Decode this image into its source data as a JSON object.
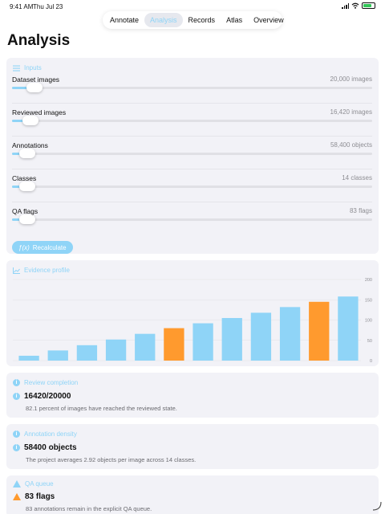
{
  "status_bar": {
    "time": "9:41 AM",
    "date": "Thu Jul 23"
  },
  "tabs": [
    {
      "label": "Annotate",
      "active": false
    },
    {
      "label": "Analysis",
      "active": true
    },
    {
      "label": "Records",
      "active": false
    },
    {
      "label": "Atlas",
      "active": false
    },
    {
      "label": "Overview",
      "active": false
    }
  ],
  "page_title": "Analysis",
  "inputs": {
    "header": "Inputs",
    "header_icon": "list-icon",
    "rows": [
      {
        "label": "Dataset images",
        "value": "20,000 images",
        "level": 0.04
      },
      {
        "label": "Reviewed images",
        "value": "16,420 images",
        "level": 0.03
      },
      {
        "label": "Annotations",
        "value": "58,400 objects",
        "level": 0.02
      },
      {
        "label": "Classes",
        "value": "14 classes",
        "level": 0.02
      },
      {
        "label": "QA flags",
        "value": "83 flags",
        "level": 0.02
      }
    ],
    "button_label": "Recalculate",
    "button_icon": "function-icon"
  },
  "evidence": {
    "header": "Evidence profile",
    "header_icon": "chart-line-icon"
  },
  "chart_data": {
    "type": "bar",
    "title": "",
    "xlabel": "",
    "ylabel": "",
    "ylim": [
      0,
      200
    ],
    "yticks": [
      "0",
      "50",
      "100",
      "150",
      "200"
    ],
    "grid": true,
    "values": [
      12,
      25,
      38,
      52,
      66,
      80,
      92,
      105,
      118,
      132,
      145,
      158
    ],
    "highlight_indices": [
      5,
      10
    ],
    "colors": {
      "normal": "#8fd4f7",
      "highlight": "#ff9a2e"
    }
  },
  "review": {
    "header": "Review completion",
    "value": "16420/20000",
    "description": "82.1 percent of images have reached the reviewed state."
  },
  "density": {
    "header": "Annotation density",
    "value": "58400 objects",
    "description": "The project averages 2.92 objects per image across 14 classes."
  },
  "qa": {
    "header": "QA queue",
    "value": "83 flags",
    "description": "83 annotations remain in the explicit QA queue."
  },
  "colors": {
    "accent": "#8fd4f7",
    "warning": "#ff9a2e",
    "card_bg": "#f2f2f7"
  }
}
